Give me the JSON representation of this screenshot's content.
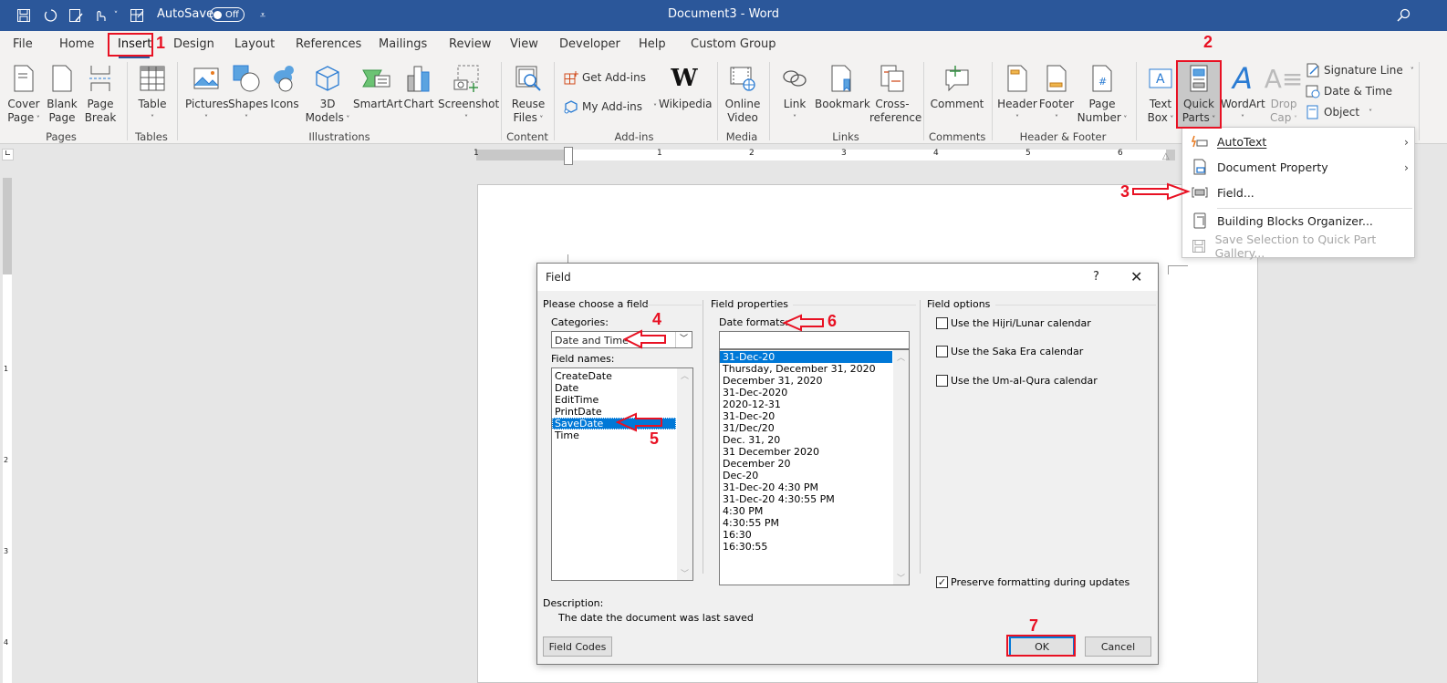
{
  "titlebar": {
    "autosave_label": "AutoSave",
    "autosave_state": "Off",
    "document_title": "Document3  -  Word",
    "icons": [
      "save-icon",
      "undo-icon",
      "touch-mode-icon",
      "customize-icon",
      "form-icon",
      "overflow-icon",
      "search-icon"
    ]
  },
  "tabs": [
    {
      "label": "File"
    },
    {
      "label": "Home"
    },
    {
      "label": "Insert",
      "active": true
    },
    {
      "label": "Design"
    },
    {
      "label": "Layout"
    },
    {
      "label": "References"
    },
    {
      "label": "Mailings"
    },
    {
      "label": "Review"
    },
    {
      "label": "View"
    },
    {
      "label": "Developer"
    },
    {
      "label": "Help"
    },
    {
      "label": "Custom Group"
    }
  ],
  "ribbon": {
    "groups": {
      "pages": "Pages",
      "tables": "Tables",
      "illustrations": "Illustrations",
      "content": "Content",
      "addins": "Add-ins",
      "media": "Media",
      "links": "Links",
      "comments": "Comments",
      "header_footer": "Header & Footer"
    },
    "buttons": {
      "cover_page": "Cover\nPage",
      "blank_page": "Blank\nPage",
      "page_break": "Page\nBreak",
      "table": "Table",
      "pictures": "Pictures",
      "shapes": "Shapes",
      "icons": "Icons",
      "models3d": "3D\nModels",
      "smartart": "SmartArt",
      "chart": "Chart",
      "screenshot": "Screenshot",
      "reuse_files": "Reuse\nFiles",
      "get_addins": "Get Add-ins",
      "my_addins": "My Add-ins",
      "wikipedia": "Wikipedia",
      "online_video": "Online\nVideo",
      "link": "Link",
      "bookmark": "Bookmark",
      "cross_reference": "Cross-\nreference",
      "comment": "Comment",
      "header": "Header",
      "footer": "Footer",
      "page_number": "Page\nNumber",
      "text_box": "Text\nBox",
      "quick_parts": "Quick\nParts",
      "wordart": "WordArt",
      "drop_cap": "Drop\nCap",
      "signature_line": "Signature Line",
      "date_time": "Date & Time",
      "object": "Object"
    }
  },
  "quick_parts_menu": {
    "items": [
      {
        "label": "AutoText",
        "mnemonic": "A",
        "submenu": true,
        "enabled": true
      },
      {
        "label": "Document Property",
        "mnemonic": "D",
        "submenu": true,
        "enabled": true
      },
      {
        "label": "Field...",
        "mnemonic": "F",
        "submenu": false,
        "enabled": true
      },
      {
        "label": "Building Blocks Organizer...",
        "mnemonic": "B",
        "submenu": false,
        "enabled": true
      },
      {
        "label": "Save Selection to Quick Part Gallery...",
        "mnemonic": "S",
        "submenu": false,
        "enabled": false
      }
    ]
  },
  "ruler": {
    "horizontal_labels": [
      "1",
      "1",
      "2",
      "3",
      "4",
      "5",
      "6"
    ],
    "vertical_labels": [
      "1",
      "2",
      "3",
      "4"
    ]
  },
  "field_dialog": {
    "title": "Field",
    "help": "?",
    "choose_section": "Please choose a field",
    "categories_label": "Categories:",
    "category_selected": "Date and Time",
    "field_names_label": "Field names:",
    "field_names": [
      "CreateDate",
      "Date",
      "EditTime",
      "PrintDate",
      "SaveDate",
      "Time"
    ],
    "field_names_selected": "SaveDate",
    "properties_section": "Field properties",
    "date_formats_label": "Date formats:",
    "date_format_input": "",
    "date_formats": [
      "31-Dec-20",
      "Thursday, December 31, 2020",
      "December 31, 2020",
      "31-Dec-2020",
      "2020-12-31",
      "31-Dec-20",
      "31/Dec/20",
      "Dec. 31, 20",
      "31 December 2020",
      "December 20",
      "Dec-20",
      "31-Dec-20 4:30 PM",
      "31-Dec-20 4:30:55 PM",
      "4:30 PM",
      "4:30:55 PM",
      "16:30",
      "16:30:55"
    ],
    "date_formats_selected_index": 0,
    "options_section": "Field options",
    "options": [
      {
        "label": "Use the Hijri/Lunar calendar",
        "checked": false
      },
      {
        "label": "Use the Saka Era calendar",
        "checked": false
      },
      {
        "label": "Use the Um-al-Qura calendar",
        "checked": false
      }
    ],
    "preserve_formatting": {
      "label": "Preserve formatting during updates",
      "checked": true
    },
    "description_label": "Description:",
    "description_text": "The date the document was last saved",
    "field_codes_button": "Field Codes",
    "ok_button": "OK",
    "cancel_button": "Cancel"
  },
  "annotations": {
    "color": "#e81123",
    "steps": [
      "1",
      "2",
      "3",
      "4",
      "5",
      "6",
      "7"
    ]
  },
  "colors": {
    "titlebar": "#2b579a",
    "selection": "#0078d7",
    "ribbon": "#f3f2f1"
  }
}
